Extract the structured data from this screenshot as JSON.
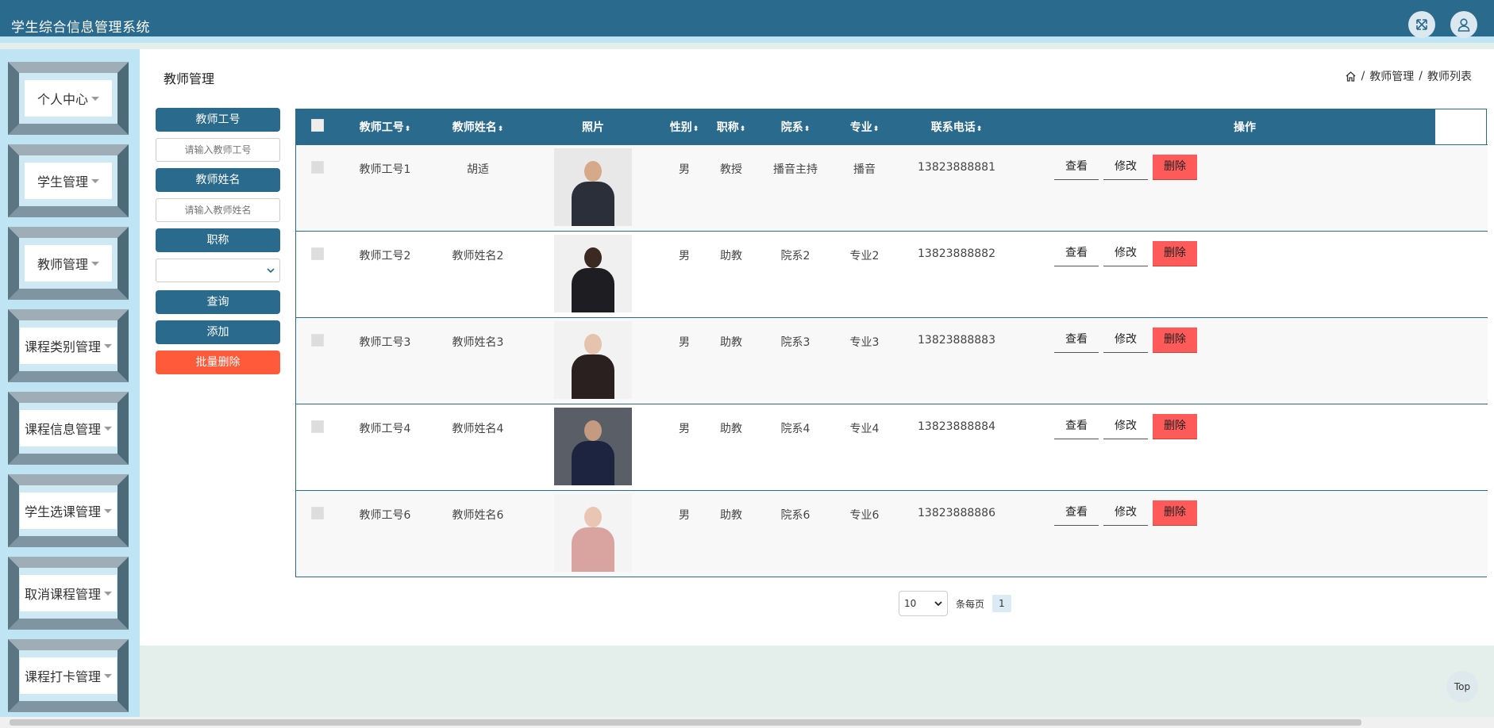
{
  "header": {
    "title": "学生综合信息管理系统",
    "fullscreen_icon": "expand-icon",
    "user_icon": "user-icon"
  },
  "sidebar": {
    "items": [
      {
        "label": "个人中心"
      },
      {
        "label": "学生管理"
      },
      {
        "label": "教师管理"
      },
      {
        "label": "课程类别管理"
      },
      {
        "label": "课程信息管理"
      },
      {
        "label": "学生选课管理"
      },
      {
        "label": "取消课程管理"
      },
      {
        "label": "课程打卡管理"
      }
    ]
  },
  "main": {
    "title": "教师管理",
    "breadcrumb": {
      "home_icon": "home-icon",
      "items": [
        "教师管理",
        "教师列表"
      ],
      "separator": "/"
    }
  },
  "search": {
    "teacher_id_label": "教师工号",
    "teacher_id_placeholder": "请输入教师工号",
    "teacher_id_value": "",
    "teacher_name_label": "教师姓名",
    "teacher_name_placeholder": "请输入教师姓名",
    "teacher_name_value": "",
    "title_label": "职称",
    "title_selected": "",
    "query_label": "查询",
    "add_label": "添加",
    "batch_delete_label": "批量删除"
  },
  "table": {
    "columns": [
      "教师工号",
      "教师姓名",
      "照片",
      "性别",
      "职称",
      "院系",
      "专业",
      "联系电话",
      "操作"
    ],
    "sort_glyph": "⬍",
    "rows": [
      {
        "id": "教师工号1",
        "name": "胡适",
        "gender": "男",
        "title": "教授",
        "dept": "播音主持",
        "major": "播音",
        "phone": "13823888881"
      },
      {
        "id": "教师工号2",
        "name": "教师姓名2",
        "gender": "男",
        "title": "助教",
        "dept": "院系2",
        "major": "专业2",
        "phone": "13823888882"
      },
      {
        "id": "教师工号3",
        "name": "教师姓名3",
        "gender": "男",
        "title": "助教",
        "dept": "院系3",
        "major": "专业3",
        "phone": "13823888883"
      },
      {
        "id": "教师工号4",
        "name": "教师姓名4",
        "gender": "男",
        "title": "助教",
        "dept": "院系4",
        "major": "专业4",
        "phone": "13823888884"
      },
      {
        "id": "教师工号6",
        "name": "教师姓名6",
        "gender": "男",
        "title": "助教",
        "dept": "院系6",
        "major": "专业6",
        "phone": "13823888886"
      }
    ],
    "actions": {
      "view": "查看",
      "edit": "修改",
      "delete": "删除"
    }
  },
  "pagination": {
    "page_size": "10",
    "per_page_label": "条每页",
    "current_page": "1"
  },
  "back_to_top": "Top"
}
